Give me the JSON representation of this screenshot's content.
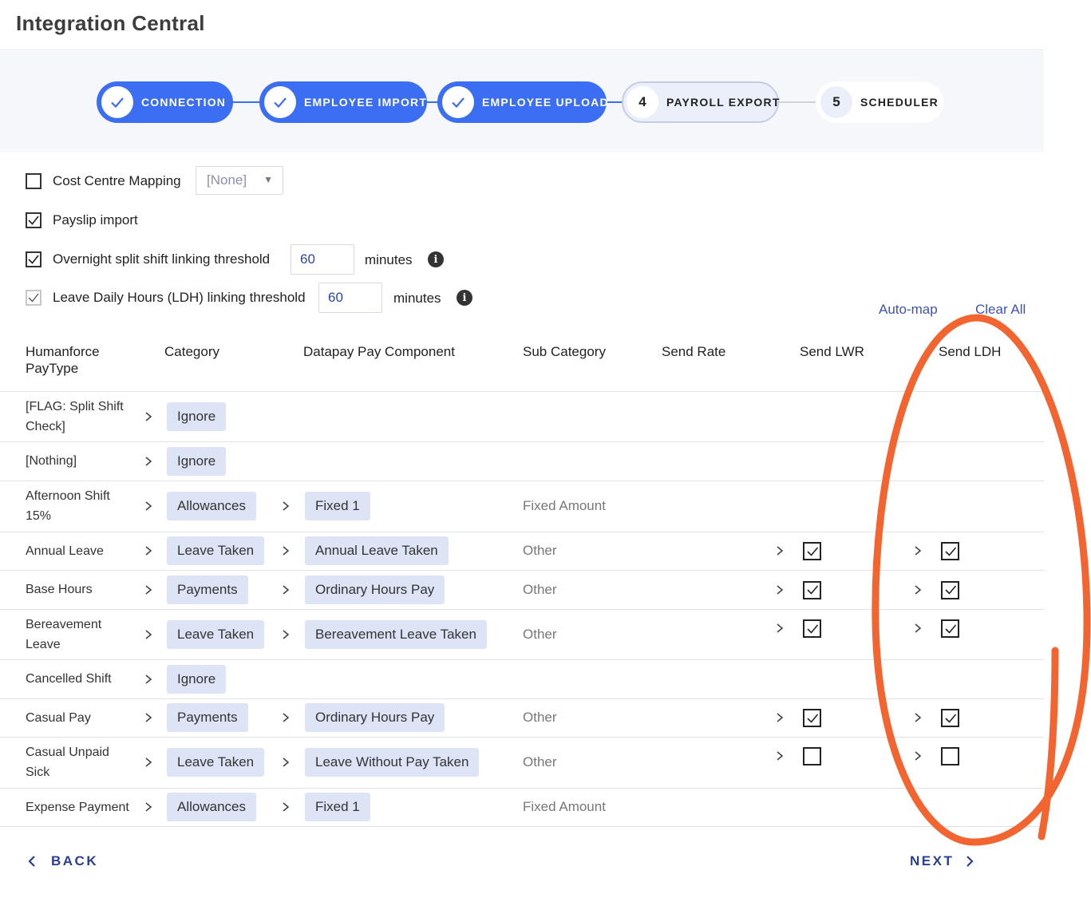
{
  "app_title": "Integration Central",
  "steps": [
    {
      "label": "CONNECTION",
      "status": "done",
      "icon": "check-icon"
    },
    {
      "label": "EMPLOYEE IMPORT",
      "status": "done",
      "icon": "check-icon"
    },
    {
      "label": "EMPLOYEE UPLOAD",
      "status": "done",
      "icon": "check-icon"
    },
    {
      "label": "PAYROLL EXPORT",
      "status": "current",
      "number": "4"
    },
    {
      "label": "SCHEDULER",
      "status": "todo",
      "number": "5"
    }
  ],
  "options": {
    "cost_centre": {
      "label": "Cost Centre Mapping",
      "checked": false,
      "select_value": "[None]"
    },
    "payslip": {
      "label": "Payslip import",
      "checked": true
    },
    "overnight": {
      "label": "Overnight split shift linking threshold",
      "checked": true,
      "value": "60",
      "unit": "minutes"
    },
    "ldh": {
      "label": "Leave Daily Hours (LDH) linking threshold",
      "checked": true,
      "value": "60",
      "unit": "minutes"
    }
  },
  "actions": {
    "auto_map": "Auto-map",
    "clear_all": "Clear All"
  },
  "table": {
    "columns": {
      "paytype_line1": "Humanforce",
      "paytype_line2": "PayType",
      "category": "Category",
      "component": "Datapay Pay Component",
      "subcategory": "Sub Category",
      "send_rate": "Send Rate",
      "send_lwr": "Send LWR",
      "send_ldh": "Send LDH"
    },
    "rows": [
      {
        "paytype": [
          "[FLAG: Split Shift",
          "Check]"
        ],
        "category": "Ignore"
      },
      {
        "paytype": [
          "[Nothing]"
        ],
        "category": "Ignore"
      },
      {
        "paytype": [
          "Afternoon Shift",
          "15%"
        ],
        "category": "Allowances",
        "component": "Fixed 1",
        "subcategory": "Fixed Amount"
      },
      {
        "paytype": [
          "Annual Leave"
        ],
        "category": "Leave Taken",
        "component": "Annual Leave Taken",
        "subcategory": "Other",
        "lwr": true,
        "ldh": true
      },
      {
        "paytype": [
          "Base Hours"
        ],
        "category": "Payments",
        "component": "Ordinary Hours Pay",
        "subcategory": "Other",
        "lwr": true,
        "ldh": true
      },
      {
        "paytype": [
          "Bereavement",
          "Leave"
        ],
        "category": "Leave Taken",
        "component": "Bereavement Leave Taken",
        "subcategory": "Other",
        "lwr": true,
        "ldh": true
      },
      {
        "paytype": [
          "Cancelled Shift"
        ],
        "category": "Ignore"
      },
      {
        "paytype": [
          "Casual Pay"
        ],
        "category": "Payments",
        "component": "Ordinary Hours Pay",
        "subcategory": "Other",
        "lwr": true,
        "ldh": true
      },
      {
        "paytype": [
          "Casual Unpaid",
          "Sick"
        ],
        "category": "Leave Taken",
        "component": "Leave Without Pay Taken",
        "subcategory": "Other",
        "lwr": false,
        "ldh": false
      },
      {
        "paytype": [
          "Expense Payment"
        ],
        "category": "Allowances",
        "component": "Fixed 1",
        "subcategory": "Fixed Amount"
      }
    ]
  },
  "footer": {
    "back": "BACK",
    "next": "NEXT"
  },
  "annotation_color": "#f26531",
  "accent_color": "#3b6ef2"
}
